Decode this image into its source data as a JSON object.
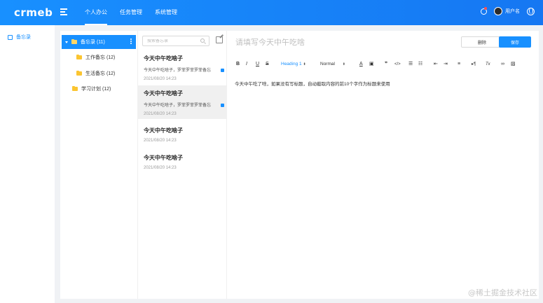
{
  "app": {
    "logo_text": "crmeb"
  },
  "nav": {
    "items": [
      {
        "label": "个人办公",
        "active": true
      },
      {
        "label": "任务管理",
        "active": false
      },
      {
        "label": "系统管理",
        "active": false
      }
    ]
  },
  "user": {
    "name": "用户名"
  },
  "sidebar": {
    "items": [
      {
        "label": "备忘录",
        "icon": "book-icon",
        "active": true
      }
    ]
  },
  "folders": {
    "root": {
      "label": "备忘录 (11)",
      "expanded": true
    },
    "children": [
      {
        "label": "工作备忘 (12)"
      },
      {
        "label": "生活备忘 (12)"
      }
    ],
    "others": [
      {
        "label": "学习计划 (12)"
      }
    ]
  },
  "notes": {
    "search_placeholder": "搜索备忘录",
    "items": [
      {
        "title": "今天中午吃啥子",
        "preview": "今天中午吃啥子，罗菲罗菲罗菲备忘",
        "date": "2021/08/20 14:23",
        "active": false,
        "shared": true
      },
      {
        "title": "今天中午吃啥子",
        "preview": "今天中午吃啥子，罗菲罗菲罗菲备忘",
        "date": "2021/08/20 14:23",
        "active": true,
        "shared": true
      },
      {
        "title": "今天中午吃啥子",
        "preview": "",
        "date": "2021/08/20 14:23",
        "active": false,
        "shared": false
      },
      {
        "title": "今天中午吃啥子",
        "preview": "",
        "date": "2021/08/20 14:23",
        "active": false,
        "shared": false
      }
    ]
  },
  "editor": {
    "title_placeholder": "请填写今天中午吃啥",
    "delete_label": "删除",
    "save_label": "保存",
    "toolbar": {
      "bold": "B",
      "italic": "I",
      "underline": "U",
      "strike": "S",
      "heading": "Heading 1",
      "size": "Normal",
      "font_color": "A",
      "quote": "❞",
      "code": "</>",
      "direction": "▸¶",
      "clean": "Tx"
    },
    "body_text": "今天中午吃了啥，如果没有写标题，自动截取内容的前10个字作为标题来使用"
  },
  "watermark": "@稀土掘金技术社区",
  "colors": {
    "primary": "#1890ff",
    "folder": "#fbc531",
    "bg": "#f0f2f5"
  }
}
